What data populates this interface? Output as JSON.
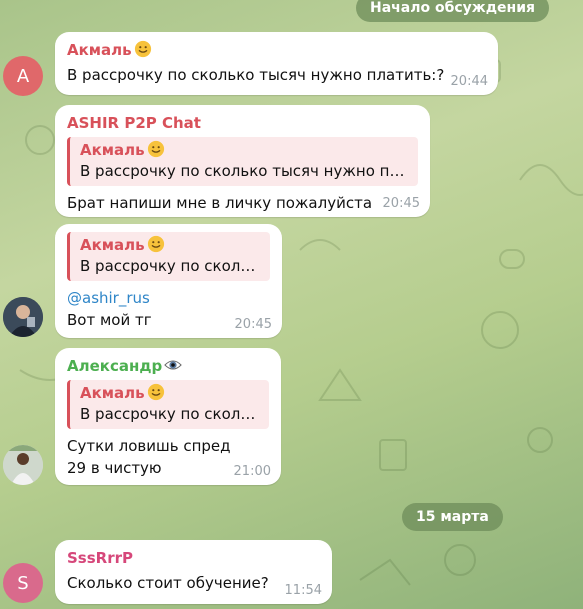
{
  "header": {
    "discussion_start": "Начало обсуждения",
    "date_divider": "15 марта"
  },
  "colors": {
    "red": "#d8515a",
    "green": "#4caf50",
    "link": "#2f86c8",
    "avatar_a": "#e0686a",
    "avatar_s": "#d96a8c"
  },
  "messages": [
    {
      "avatar_letter": "А",
      "sender": "Акмаль",
      "text": "В рассрочку по сколько тысяч нужно платить:?",
      "time": "20:44"
    },
    {
      "sender": "ASHIR P2P Chat",
      "quote_name": "Акмаль",
      "quote_text": "В рассрочку по сколько тысяч нужно пл...",
      "text": "Брат напиши мне в личку пожалуйста",
      "time": "20:45"
    },
    {
      "quote_name": "Акмаль",
      "quote_text": "В рассрочку по сколь...",
      "link": "@ashir_rus",
      "text": "Вот мой тг",
      "time": "20:45"
    },
    {
      "sender": "Александр",
      "quote_name": "Акмаль",
      "quote_text": "В рассрочку по сколь...",
      "text_line1": "Сутки ловишь спред",
      "text_line2": "29 в чистую",
      "time": "21:00"
    },
    {
      "avatar_letter": "S",
      "sender": "SssRrrP",
      "text": "Сколько стоит обучение?",
      "time": "11:54"
    }
  ]
}
